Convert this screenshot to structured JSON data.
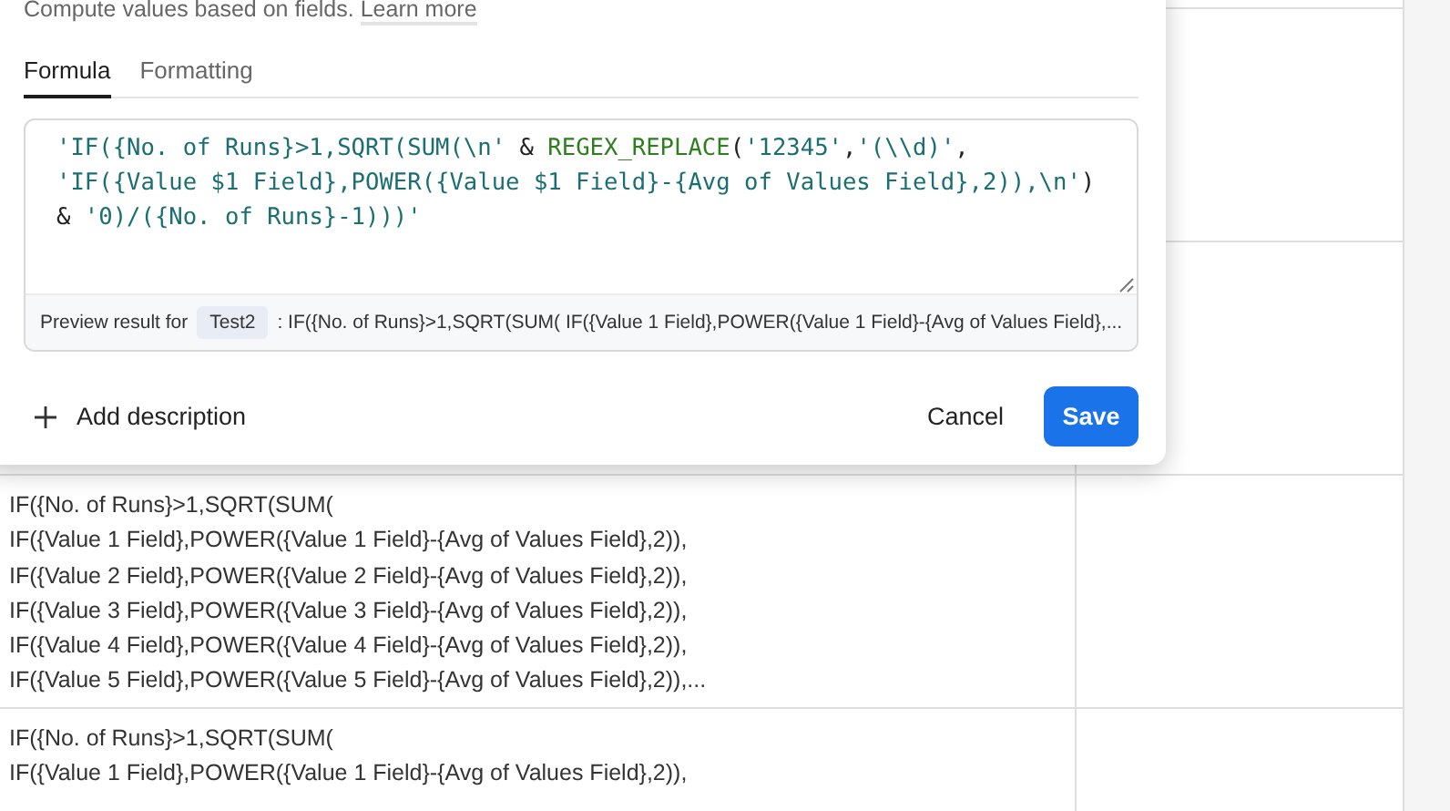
{
  "dialog": {
    "description": "Compute values based on fields.",
    "learn_more": "Learn more",
    "tabs": [
      {
        "label": "Formula",
        "selected": true
      },
      {
        "label": "Formatting",
        "selected": false
      }
    ],
    "formula_lines": [
      [
        {
          "kind": "string",
          "text": "'IF({No. of Runs}>1,SQRT(SUM(\\n'"
        },
        {
          "kind": "operator",
          "text": " & "
        },
        {
          "kind": "function",
          "text": "REGEX_REPLACE"
        },
        {
          "kind": "operator",
          "text": "("
        },
        {
          "kind": "string",
          "text": "'12345'"
        },
        {
          "kind": "operator",
          "text": ","
        },
        {
          "kind": "string",
          "text": "'(\\\\d)'"
        },
        {
          "kind": "operator",
          "text": ","
        }
      ],
      [
        {
          "kind": "string",
          "text": "'IF({Value $1 Field},POWER({Value $1 Field}-{Avg of Values Field},2)),\\n'"
        },
        {
          "kind": "operator",
          "text": ")"
        }
      ],
      [
        {
          "kind": "operator",
          "text": "& "
        },
        {
          "kind": "string",
          "text": "'0)/({No. of Runs}-1)))'"
        }
      ]
    ],
    "preview": {
      "label": "Preview result for",
      "record": "Test2",
      "result": ": IF({No. of Runs}>1,SQRT(SUM( IF({Value 1 Field},POWER({Value 1 Field}-{Avg of Values Field},..."
    },
    "add_description": "Add description",
    "cancel": "Cancel",
    "save": "Save"
  },
  "table": {
    "rows": [
      {
        "lines": [
          "IF({No. of Runs}>1,SQRT(SUM(",
          "IF({Value 1 Field},POWER({Value 1 Field}-{Avg of Values Field},2)),",
          "IF({Value 2 Field},POWER({Value 2 Field}-{Avg of Values Field},2)),",
          "IF({Value 3 Field},POWER({Value 3 Field}-{Avg of Values Field},2)),",
          "IF({Value 4 Field},POWER({Value 4 Field}-{Avg of Values Field},2)),",
          "IF({Value 5 Field},POWER({Value 5 Field}-{Avg of Values Field},2)),..."
        ]
      },
      {
        "lines": [
          "IF({No. of Runs}>1,SQRT(SUM(",
          "IF({Value 1 Field},POWER({Value 1 Field}-{Avg of Values Field},2)),"
        ]
      }
    ]
  }
}
